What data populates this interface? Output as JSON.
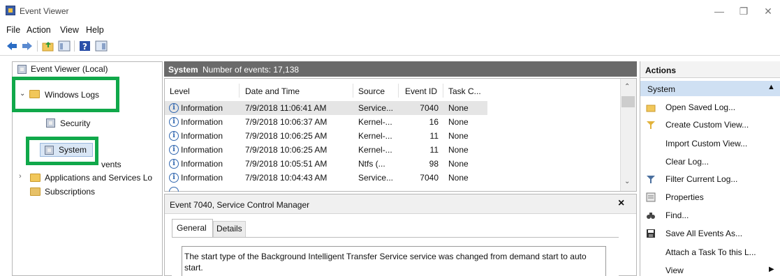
{
  "window": {
    "title": "Event Viewer",
    "minimize": "—",
    "maximize": "❐",
    "close": "✕"
  },
  "menu": [
    "File",
    "Action",
    "View",
    "Help"
  ],
  "toolbar": {
    "icons": [
      "back-arrow-icon",
      "forward-arrow-icon",
      "up-folder-icon",
      "show-hide-tree-icon",
      "help-icon",
      "show-hide-action-pane-icon"
    ]
  },
  "tree": {
    "root": "Event Viewer (Local)",
    "windows_logs": "Windows Logs",
    "security": "Security",
    "system": "System",
    "forwarded_tail": "vents",
    "apps_services": "Applications and Services Lo",
    "subscriptions": "Subscriptions"
  },
  "center": {
    "log_name": "System",
    "event_count": "Number of events: 17,138",
    "columns": [
      "Level",
      "Date and Time",
      "Source",
      "Event ID",
      "Task C..."
    ],
    "rows": [
      {
        "level": "Information",
        "date": "7/9/2018 11:06:41 AM",
        "source": "Service...",
        "event_id": "7040",
        "task": "None"
      },
      {
        "level": "Information",
        "date": "7/9/2018 10:06:37 AM",
        "source": "Kernel-...",
        "event_id": "16",
        "task": "None"
      },
      {
        "level": "Information",
        "date": "7/9/2018 10:06:25 AM",
        "source": "Kernel-...",
        "event_id": "11",
        "task": "None"
      },
      {
        "level": "Information",
        "date": "7/9/2018 10:06:25 AM",
        "source": "Kernel-...",
        "event_id": "11",
        "task": "None"
      },
      {
        "level": "Information",
        "date": "7/9/2018 10:05:51 AM",
        "source": "Ntfs (...",
        "event_id": "98",
        "task": "None"
      },
      {
        "level": "Information",
        "date": "7/9/2018 10:04:43 AM",
        "source": "Service...",
        "event_id": "7040",
        "task": "None"
      }
    ],
    "detail_title": "Event 7040, Service Control Manager",
    "detail_close": "×",
    "tabs": [
      "General",
      "Details"
    ],
    "description": "The start type of the Background Intelligent Transfer Service service was changed from demand start to auto start."
  },
  "actions": {
    "title": "Actions",
    "section": "System",
    "items": [
      {
        "label": "Open Saved Log...",
        "icon": "open-folder-icon"
      },
      {
        "label": "Create Custom View...",
        "icon": "filter-icon"
      },
      {
        "label": "Import Custom View...",
        "icon": ""
      },
      {
        "label": "Clear Log...",
        "icon": ""
      },
      {
        "label": "Filter Current Log...",
        "icon": "filter-icon"
      },
      {
        "label": "Properties",
        "icon": "properties-icon"
      },
      {
        "label": "Find...",
        "icon": "binoculars-icon"
      },
      {
        "label": "Save All Events As...",
        "icon": "save-icon"
      },
      {
        "label": "Attach a Task To this L...",
        "icon": ""
      },
      {
        "label": "View",
        "icon": ""
      }
    ]
  },
  "colors": {
    "highlight": "#10a84a",
    "header_gray": "#6a6a6a",
    "actions_section": "#cfe0f3",
    "info_blue": "#3368b0"
  }
}
